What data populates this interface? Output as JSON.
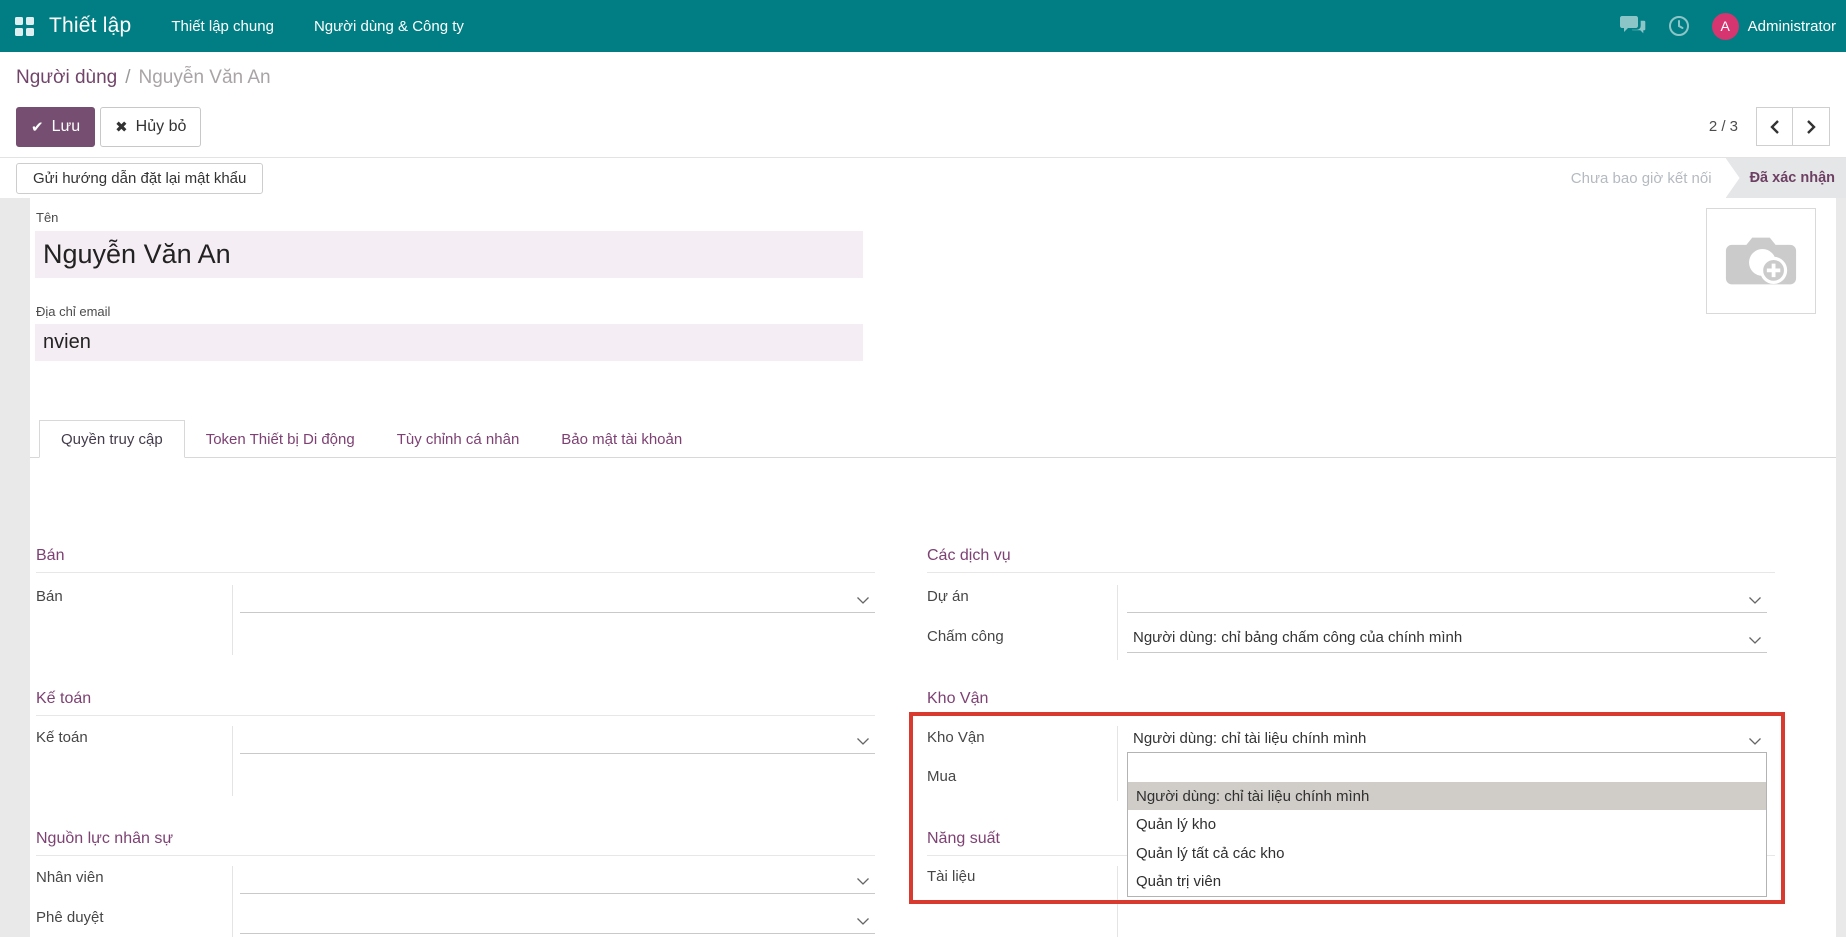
{
  "topbar": {
    "app_title": "Thiết lập",
    "menu_items": [
      {
        "label": "Thiết lập chung"
      },
      {
        "label": "Người dùng & Công ty"
      }
    ],
    "user_initial": "A",
    "user_name": "Administrator",
    "colors": {
      "bar": "#017e84",
      "avatar": "#d6356f"
    }
  },
  "breadcrumb": {
    "parent": "Người dùng",
    "separator": "/",
    "current": "Nguyễn Văn An"
  },
  "actions": {
    "save_label": "Lưu",
    "discard_label": "Hủy bỏ"
  },
  "pager": {
    "text": "2 / 3"
  },
  "action_bar": {
    "reset_password_label": "Gửi hướng dẫn đặt lại mật khẩu"
  },
  "statusbar": {
    "inactive": "Chưa bao giờ kết nối",
    "active": "Đã xác nhận"
  },
  "record": {
    "name_label": "Tên",
    "name_value": "Nguyễn Văn An",
    "email_label": "Địa chỉ email",
    "email_value": "nvien"
  },
  "tabs": {
    "items": [
      {
        "label": "Quyền truy cập",
        "active": true
      },
      {
        "label": "Token Thiết bị Di động",
        "active": false
      },
      {
        "label": "Tùy chỉnh cá nhân",
        "active": false
      },
      {
        "label": "Bảo mật tài khoản",
        "active": false
      }
    ]
  },
  "groups": {
    "left": [
      {
        "title": "Bán",
        "fields": [
          {
            "label": "Bán",
            "value": ""
          }
        ]
      },
      {
        "title": "Kế toán",
        "fields": [
          {
            "label": "Kế toán",
            "value": ""
          }
        ]
      },
      {
        "title": "Nguồn lực nhân sự",
        "fields": [
          {
            "label": "Nhân viên",
            "value": ""
          },
          {
            "label": "Phê duyệt",
            "value": ""
          }
        ]
      }
    ],
    "right": [
      {
        "title": "Các dịch vụ",
        "fields": [
          {
            "label": "Dự án",
            "value": ""
          },
          {
            "label": "Chấm công",
            "value": "Người dùng: chỉ bảng chấm công của chính mình"
          }
        ]
      },
      {
        "title": "Kho Vận",
        "fields": [
          {
            "label": "Kho Vận",
            "value": "Người dùng: chỉ tài liệu chính mình"
          },
          {
            "label": "Mua",
            "value": ""
          }
        ]
      },
      {
        "title": "Năng suất",
        "fields": [
          {
            "label": "Tài liệu",
            "value": ""
          }
        ]
      }
    ]
  },
  "dropdown": {
    "options": [
      "",
      "Người dùng: chỉ tài liệu chính mình",
      "Quản lý kho",
      "Quản lý tất cả các kho",
      "Quản trị viên"
    ],
    "selected_index": 1
  },
  "annotation": {
    "color": "#d83a30"
  }
}
